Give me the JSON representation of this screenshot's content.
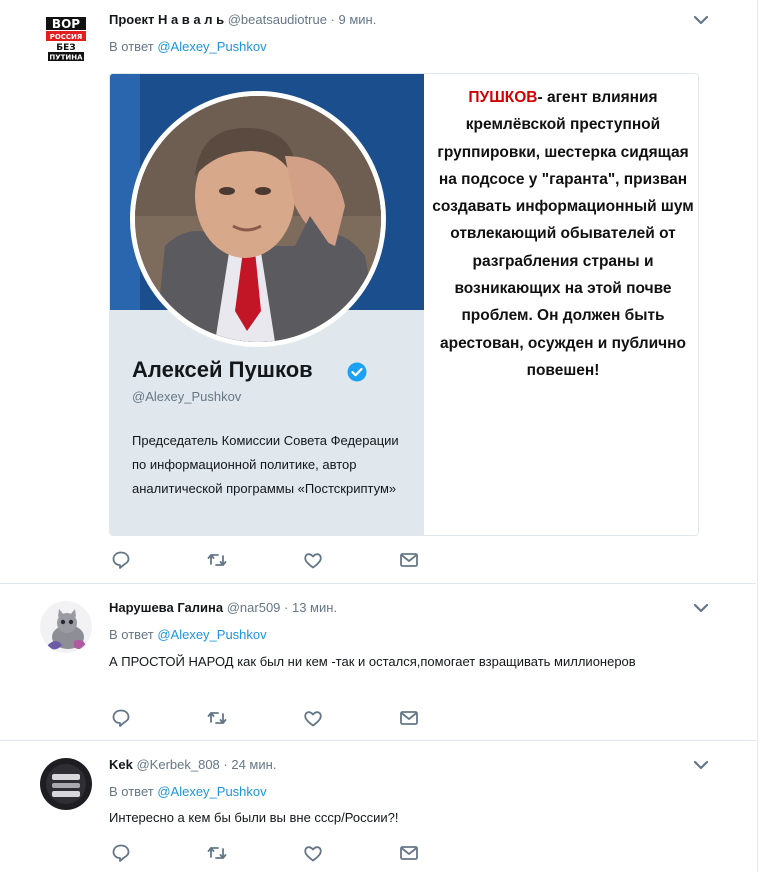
{
  "tweets": [
    {
      "author_name": "Проект Н а в а л ь",
      "handle": "@beatsaudiotrue",
      "time": "· 9 мин.",
      "reply_prefix": "В ответ",
      "reply_to": "@Alexey_Pushkov",
      "avatar_text": [
        "ВОР",
        "РОССИЯ",
        "БЕЗ",
        "ПУТИНА"
      ],
      "card": {
        "profile_name": "Алексей Пушков",
        "profile_handle": "@Alexey_Pushkov",
        "profile_bio": "Председатель Комиссии Совета Федерации по информационной политике, автор аналитической программы «Постскриптум»",
        "quote_highlight": "ПУШКОВ",
        "quote_text": "- агент влияния кремлёвской преступной группировки, шестерка сидящая на подсосе у \"гаранта\", призван создавать информационный шум отвлекающий обывателей от разграбления страны и возникающих на этой почве проблем. Он должен быть арестован, осужден и публично повешен!"
      }
    },
    {
      "author_name": "Нарушева Галина",
      "handle": "@nar509",
      "time": "· 13 мин.",
      "reply_prefix": "В ответ",
      "reply_to": "@Alexey_Pushkov",
      "text": "А ПРОСТОЙ НАРОД как был ни кем -так и остался,помогает взращивать миллионеров"
    },
    {
      "author_name": "Kek",
      "handle": "@Kerbek_808",
      "time": "· 24 мин.",
      "reply_prefix": "В ответ",
      "reply_to": "@Alexey_Pushkov",
      "text": "Интересно а кем бы были вы вне ссср/России?!"
    }
  ],
  "icons": [
    "reply-icon",
    "retweet-icon",
    "like-icon",
    "direct-message-icon",
    "chevron-down-icon",
    "verified-badge-icon"
  ],
  "colors": {
    "link": "#1b95e0",
    "secondary_text": "#657786",
    "separator": "#e1e8ed",
    "banner": "#1a4e8d",
    "highlight_red": "#d40000"
  }
}
